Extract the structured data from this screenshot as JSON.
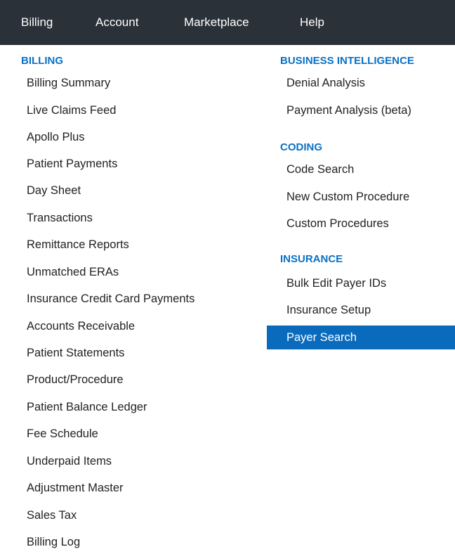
{
  "topnav": {
    "billing": "Billing",
    "account": "Account",
    "marketplace": "Marketplace",
    "help": "Help"
  },
  "menu": {
    "billing_section": {
      "heading": "BILLING",
      "items": [
        "Billing Summary",
        "Live Claims Feed",
        "Apollo Plus",
        "Patient Payments",
        "Day Sheet",
        "Transactions",
        "Remittance Reports",
        "Unmatched ERAs",
        "Insurance Credit Card Payments",
        "Accounts Receivable",
        "Patient Statements",
        "Product/Procedure",
        "Patient Balance Ledger",
        "Fee Schedule",
        "Underpaid Items",
        "Adjustment Master",
        "Sales Tax",
        "Billing Log"
      ]
    },
    "bi_section": {
      "heading": "BUSINESS INTELLIGENCE",
      "items": [
        "Denial Analysis",
        "Payment Analysis (beta)"
      ]
    },
    "coding_section": {
      "heading": "CODING",
      "items": [
        "Code Search",
        "New Custom Procedure",
        "Custom Procedures"
      ]
    },
    "insurance_section": {
      "heading": "INSURANCE",
      "items": [
        "Bulk Edit Payer IDs",
        "Insurance Setup",
        "Payer Search"
      ],
      "selected": "Payer Search"
    }
  },
  "colors": {
    "topbar": "#2b3138",
    "section_heading": "#0a71c4",
    "selected_item": "#0a6bbd"
  }
}
